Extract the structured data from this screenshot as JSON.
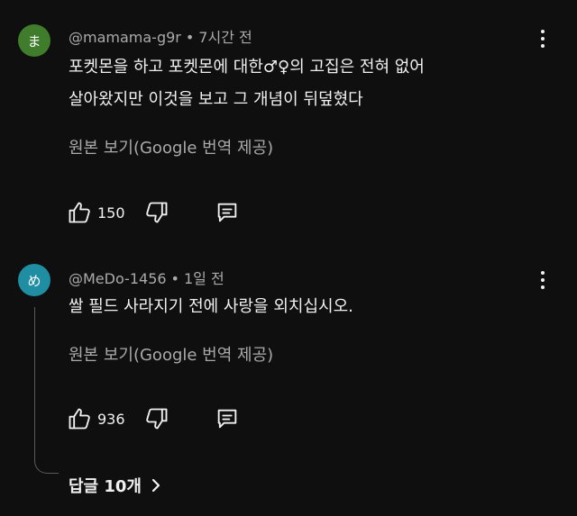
{
  "comments": [
    {
      "avatar_initial": "ま",
      "avatar_color": "#3f7d2c",
      "author": "@mamama-g9r",
      "time": "7시간 전",
      "lines": [
        "포켓몬을 하고 포켓몬에 대한♂♀의 고집은 전혀 없어",
        "살아왔지만 이것을 보고 그 개념이 뒤덮혔다"
      ],
      "translate_label": "원본 보기(Google 번역 제공)",
      "likes": "150"
    },
    {
      "avatar_initial": "め",
      "avatar_color": "#1f8ea3",
      "author": "@MeDo-1456",
      "time": "1일 전",
      "lines": [
        "쌀 필드 사라지기 전에 사랑을 외치십시오."
      ],
      "translate_label": "원본 보기(Google 번역 제공)",
      "likes": "936"
    }
  ],
  "separator": "•",
  "replies_label": "답글 10개",
  "icons": {
    "like": "thumb-up-icon",
    "dislike": "thumb-down-icon",
    "reply": "comment-icon",
    "more": "more-vert-icon",
    "expand": "chevron-right-icon"
  }
}
